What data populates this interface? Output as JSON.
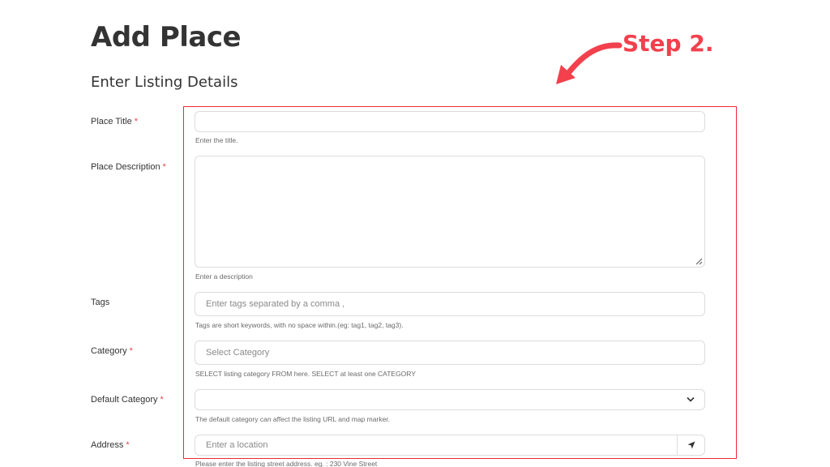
{
  "header": {
    "title": "Add Place",
    "section": "Enter Listing Details"
  },
  "annotation": {
    "step_text": "Step 2.",
    "color": "#f2404d",
    "arrow_icon": "curved-arrow-icon"
  },
  "form": {
    "required_marker": "*",
    "place_title": {
      "label": "Place Title",
      "value": "",
      "help": "Enter the title."
    },
    "place_description": {
      "label": "Place Description",
      "value": "",
      "help": "Enter a description"
    },
    "tags": {
      "label": "Tags",
      "placeholder": "Enter tags separated by a comma ,",
      "help": "Tags are short keywords, with no space within.(eg: tag1, tag2, tag3)."
    },
    "category": {
      "label": "Category",
      "placeholder": "Select Category",
      "help": "SELECT listing category FROM here. SELECT at least one CATEGORY"
    },
    "default_category": {
      "label": "Default Category",
      "selected": "",
      "help": "The default category can affect the listing URL and map marker."
    },
    "address": {
      "label": "Address",
      "placeholder": "Enter a location",
      "help": "Please enter the listing street address. eg. : 230 Vine Street",
      "locate_icon": "location-arrow-icon"
    }
  }
}
